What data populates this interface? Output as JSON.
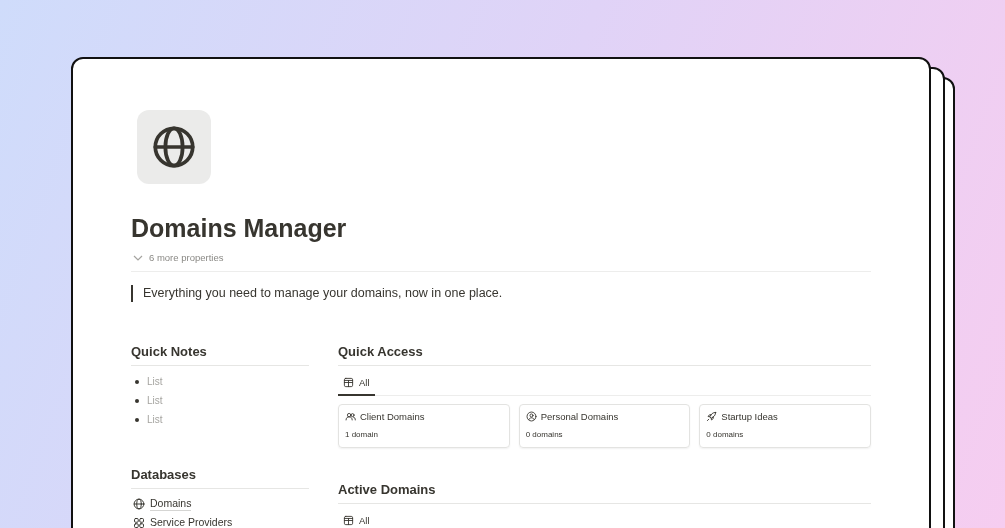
{
  "page": {
    "title": "Domains Manager",
    "properties_toggle": "6 more properties",
    "quote": "Everything you need to manage your domains, now in one place."
  },
  "quick_notes": {
    "heading": "Quick Notes",
    "items": [
      "List",
      "List",
      "List"
    ]
  },
  "databases": {
    "heading": "Databases",
    "items": [
      "Domains",
      "Service Providers"
    ]
  },
  "quick_access": {
    "heading": "Quick Access",
    "tabs": [
      {
        "label": "All",
        "selected": true
      }
    ],
    "cards": [
      {
        "title": "Client Domains",
        "count": "1 domain"
      },
      {
        "title": "Personal Domains",
        "count": "0 domains"
      },
      {
        "title": "Startup Ideas",
        "count": "0 domains"
      }
    ]
  },
  "active_domains": {
    "heading": "Active Domains",
    "tabs": [
      {
        "label": "All"
      }
    ]
  }
}
